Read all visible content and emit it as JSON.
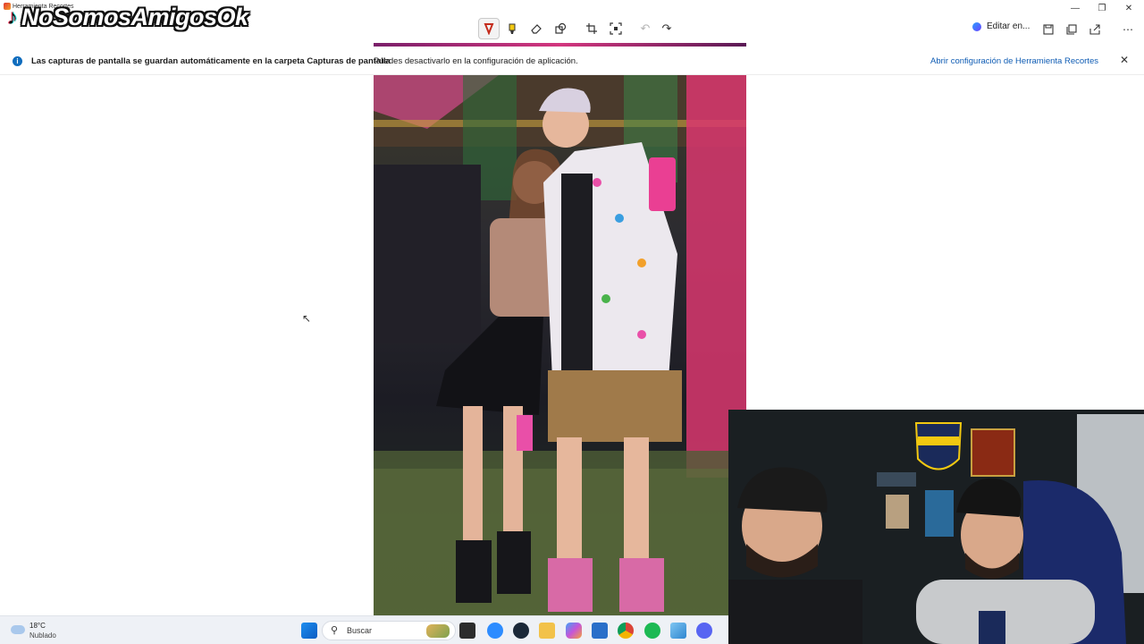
{
  "window": {
    "app_title": "Herramienta Recortes"
  },
  "watermark": {
    "logo": "tiktok-logo",
    "text": "NoSomosAmigosOk"
  },
  "toolbar": {
    "tools": [
      {
        "name": "pen-icon",
        "active": true
      },
      {
        "name": "highlighter-icon",
        "active": false
      },
      {
        "name": "eraser-icon",
        "active": false
      },
      {
        "name": "shapes-icon",
        "active": false
      },
      {
        "name": "crop-icon",
        "active": false
      },
      {
        "name": "text-actions-icon",
        "active": false
      },
      {
        "name": "undo-icon",
        "active": false
      },
      {
        "name": "redo-icon",
        "active": false
      }
    ],
    "edit_in_label": "Editar en...",
    "right_icons": [
      "save-icon",
      "copy-icon",
      "share-icon",
      "more-icon"
    ]
  },
  "notification": {
    "bold_text": "Las capturas de pantalla se guardan automáticamente en la carpeta Capturas de pantalla",
    "text": "Puedes desactivarlo en la configuración de aplicación.",
    "link": "Abrir configuración de Herramienta Recortes"
  },
  "taskbar": {
    "weather": {
      "temp": "18°C",
      "condition": "Nublado"
    },
    "search_placeholder": "Buscar",
    "apps": [
      "windows-start-icon",
      "file-manager-icon",
      "zoom-icon",
      "steam-icon",
      "explorer-folder-icon",
      "copilot-icon",
      "store-icon",
      "chrome-icon",
      "spotify-icon",
      "photos-icon",
      "discord-icon"
    ]
  },
  "colors": {
    "accent": "#0f6cbd",
    "pen_red": "#c42b1c",
    "highlighter_yellow": "#f2c811"
  }
}
